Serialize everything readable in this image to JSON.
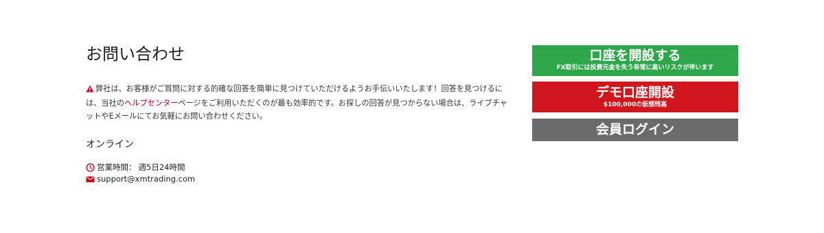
{
  "contact": {
    "title": "お問い合わせ",
    "intro_before_link": "弊社は、お客様がご質問に対する的確な回答を簡単に見つけていただけるようお手伝いいたします！回答を見つけるには、当社の",
    "help_link": "ヘルプセンター",
    "intro_after_link": "ページをご利用いただくのが最も効率的です。お探しの回答が見つからない場合は、ライブチャットやEメールにてお気軽にお問い合わせください。",
    "online_heading": "オンライン",
    "hours_label": "営業時間：",
    "hours_value": "週5日24時間",
    "email": "support@xmtrading.com"
  },
  "buttons": {
    "open_account": {
      "label": "口座を開設する",
      "sub": "FX取引には投資元金を失う非常に高いリスクが伴います"
    },
    "demo_account": {
      "label": "デモ口座開設",
      "sub": "$100,000の仮想残高"
    },
    "member_login": {
      "label": "会員ログイン"
    }
  },
  "colors": {
    "accent_red": "#d0021b",
    "open_green": "#2ea64a",
    "demo_red": "#d0171d",
    "login_gray": "#6b6b6b"
  },
  "icons": {
    "warning": "warning-triangle-icon",
    "clock": "clock-icon",
    "mail": "envelope-icon"
  }
}
